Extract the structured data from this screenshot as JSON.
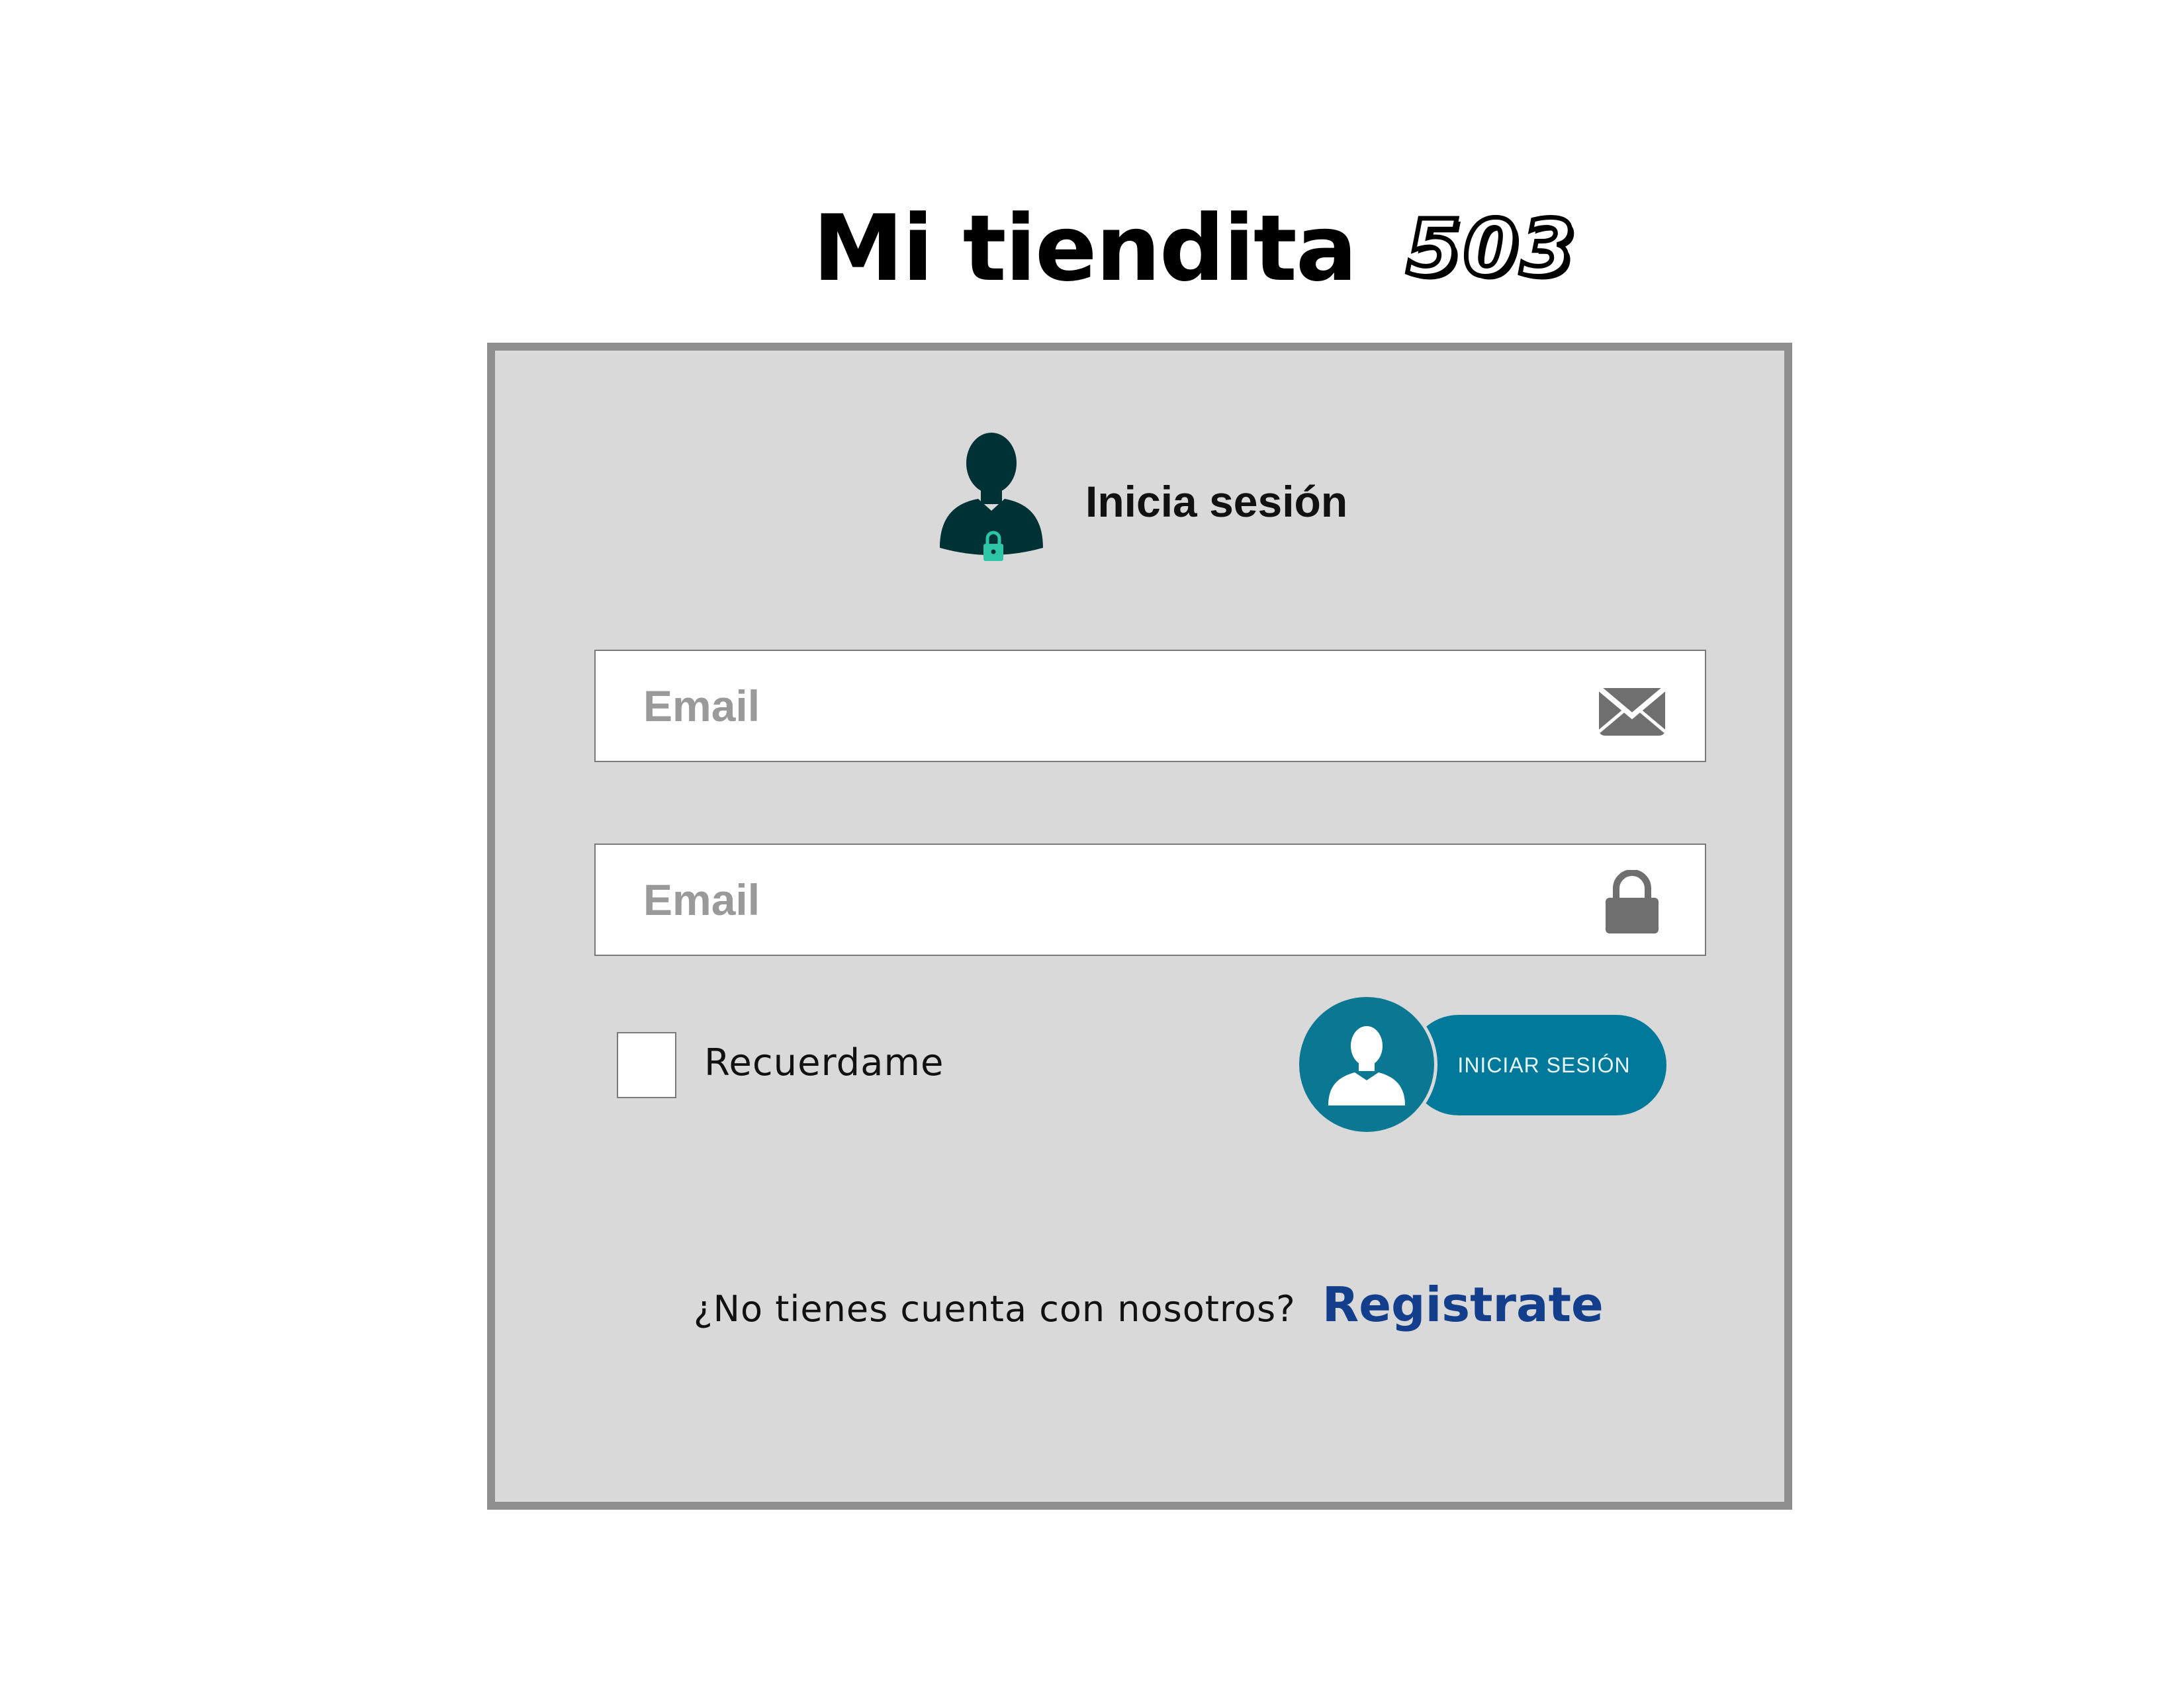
{
  "app": {
    "name": "Mi tiendita",
    "number": "503"
  },
  "login": {
    "title": "Inicia sesión",
    "email_placeholder": "Email",
    "password_placeholder": "Email",
    "remember_label": "Recuerdame",
    "remember_checked": false,
    "submit_label": "INICIAR SESIÓN"
  },
  "signup": {
    "question": "¿No tienes cuenta con nosotros?",
    "link_label": "Registrate"
  },
  "icons": {
    "header": "user-lock-icon",
    "email": "envelope-icon",
    "password": "padlock-icon",
    "button": "user-icon"
  },
  "colors": {
    "panel_bg": "#d9d9d9",
    "panel_border": "#8f8f8f",
    "button": "#00799a",
    "link": "#123e8c",
    "user_icon": "#003135",
    "lock_accent": "#2ec4a6"
  }
}
